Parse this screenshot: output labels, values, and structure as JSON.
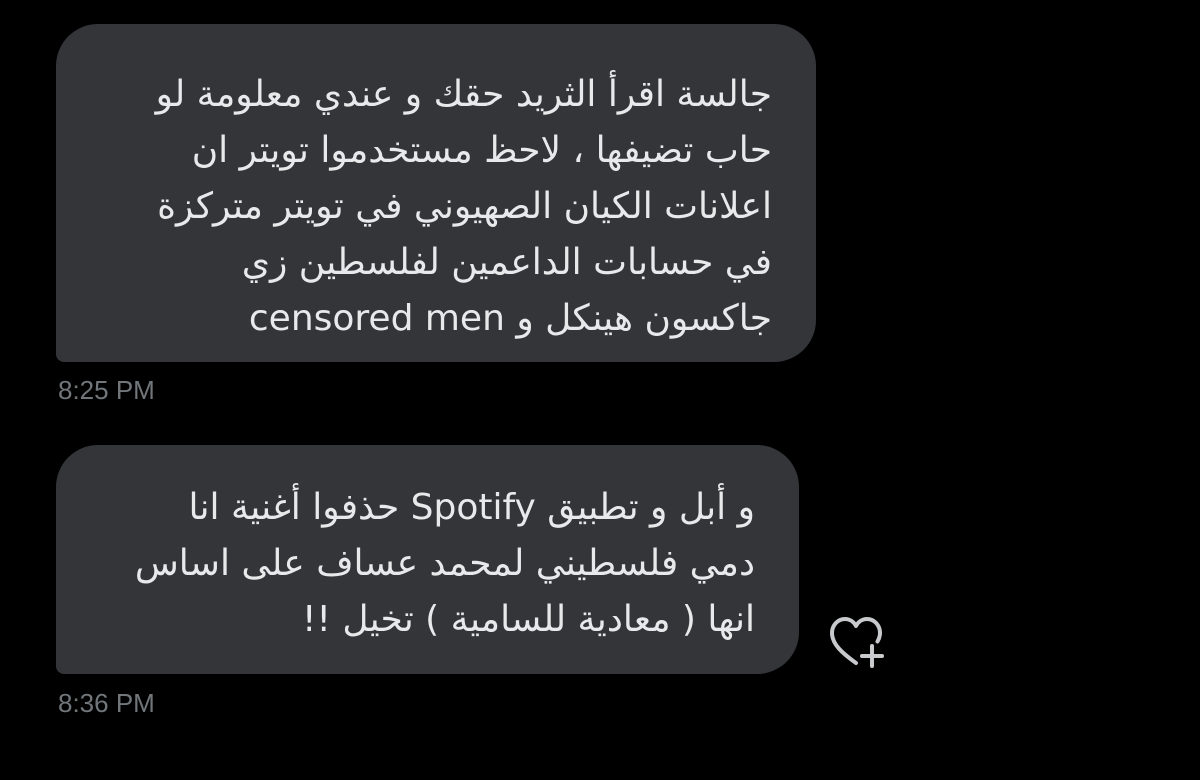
{
  "messages": [
    {
      "lines": [
        "جالسة اقرأ الثريد حقك و عندي معلومة لو",
        "حاب تضيفها ، لاحظ مستخدموا تويتر ان",
        "اعلانات الكيان الصهيوني في تويتر متركزة",
        "في حسابات الداعمين لفلسطين زي",
        "جاكسون هينكل و censored men"
      ],
      "time": "8:25 PM"
    },
    {
      "lines": [
        "و أبل و تطبيق Spotify حذفوا أغنية انا",
        "دمي فلسطيني لمحمد عساف على اساس",
        "انها ( معادية للسامية )  تخيل !!"
      ],
      "time": "8:36 PM"
    }
  ],
  "icons": {
    "reaction": "heart-plus-icon"
  },
  "colors": {
    "background": "#000000",
    "bubble": "#333538",
    "text": "#e7e9ea",
    "timestamp": "#71767b"
  }
}
